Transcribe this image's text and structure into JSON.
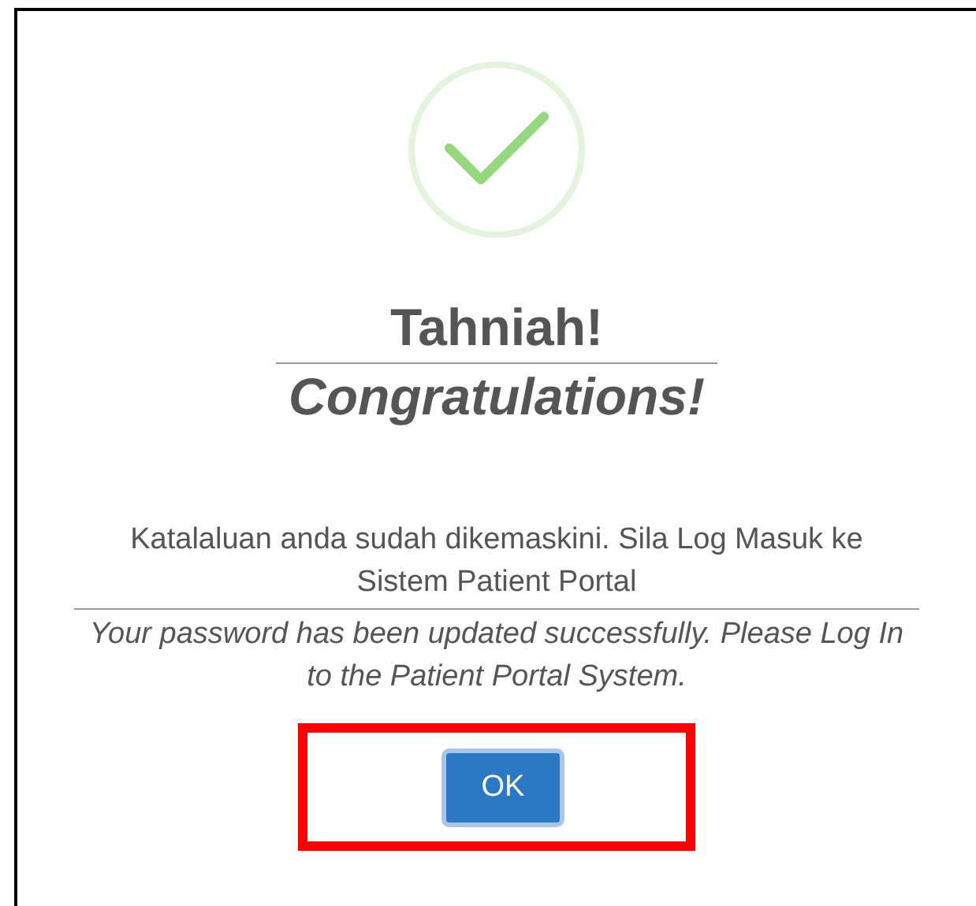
{
  "dialog": {
    "title": "Tahniah!",
    "subtitle": "Congratulations!",
    "message_ms": "Katalaluan anda sudah dikemaskini. Sila Log Masuk ke Sistem Patient Portal",
    "message_en": "Your password has been updated successfully. Please Log In to the Patient Portal System.",
    "button": {
      "label": "OK",
      "highlighted": true
    }
  }
}
